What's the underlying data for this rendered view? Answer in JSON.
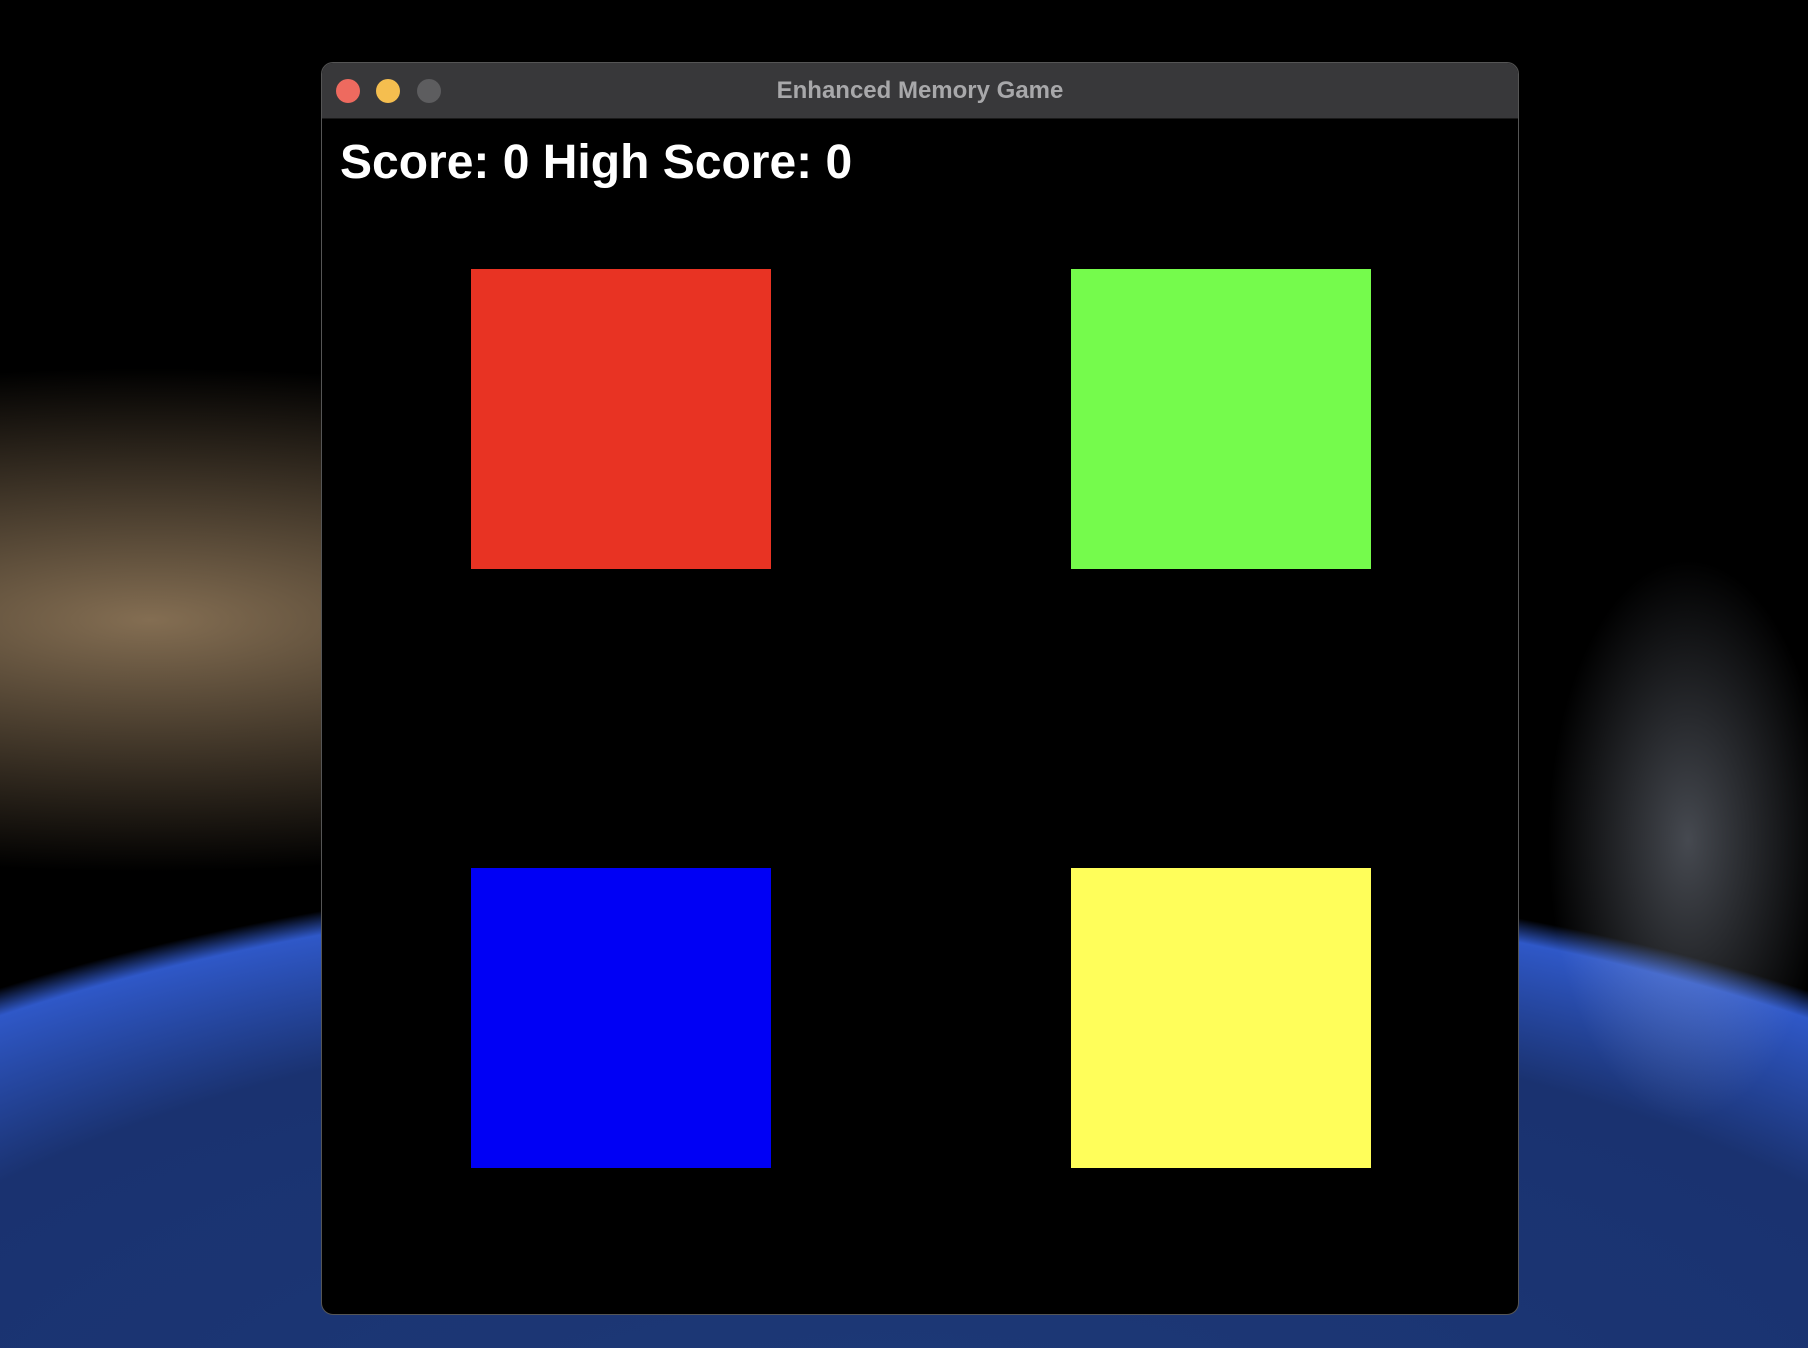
{
  "window": {
    "title": "Enhanced Memory Game"
  },
  "game": {
    "score_text": "Score: 0 High Score: 0",
    "score": 0,
    "high_score": 0,
    "tiles": [
      {
        "name": "red",
        "color": "#e83323"
      },
      {
        "name": "green",
        "color": "#75fb4c"
      },
      {
        "name": "blue",
        "color": "#0000f5"
      },
      {
        "name": "yellow",
        "color": "#fffe5a"
      }
    ]
  }
}
